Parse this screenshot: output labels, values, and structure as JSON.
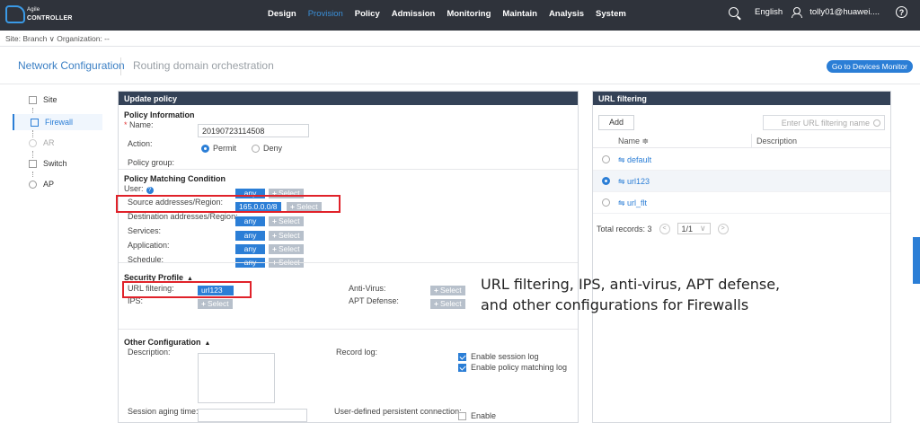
{
  "topbar": {
    "logo_line1": "Agile",
    "logo_line2": "CONTROLLER",
    "nav": [
      "Design",
      "Provision",
      "Policy",
      "Admission",
      "Monitoring",
      "Maintain",
      "Analysis",
      "System"
    ],
    "active_nav": "Provision",
    "language": "English",
    "user": "tolly01@huawei....",
    "help_icon": "?"
  },
  "breadcrumb": "Site: Branch ∨  Organization: --",
  "tabs": {
    "active": "Network Configuration",
    "other": "Routing domain orchestration",
    "go_button": "Go to Devices Monitor"
  },
  "sidebar": {
    "items": [
      {
        "label": "Site",
        "icon": "site-icon"
      },
      {
        "label": "Firewall",
        "icon": "firewall-icon"
      },
      {
        "label": "AR",
        "icon": "ar-icon"
      },
      {
        "label": "Switch",
        "icon": "switch-icon"
      },
      {
        "label": "AP",
        "icon": "ap-icon"
      }
    ],
    "active": "Firewall"
  },
  "policy": {
    "title": "Update policy",
    "info": {
      "title": "Policy Information",
      "name_label": "Name:",
      "name_value": "20190723114508",
      "action_label": "Action:",
      "permit": "Permit",
      "deny": "Deny",
      "group_label": "Policy group:"
    },
    "matching": {
      "title": "Policy Matching Condition",
      "user_label": "User:",
      "source_label": "Source addresses/Region:",
      "source_value": "165.0.0.0/8",
      "dest_label": "Destination addresses/Region:",
      "services_label": "Services:",
      "application_label": "Application:",
      "schedule_label": "Schedule:",
      "any": "any",
      "select": "Select"
    },
    "security": {
      "title": "Security Profile",
      "url_label": "URL filtering:",
      "url_value": "url123",
      "ips_label": "IPS:",
      "antivirus_label": "Anti-Virus:",
      "apt_label": "APT Defense:",
      "select": "Select"
    },
    "other": {
      "title": "Other Configuration",
      "description_label": "Description:",
      "record_log_label": "Record log:",
      "session_log": "Enable session log",
      "matching_log": "Enable policy matching log",
      "aging_label": "Session aging time:",
      "persistent_label": "User-defined persistent connection:",
      "enable": "Enable"
    }
  },
  "annotation": "URL filtering, IPS, anti-virus, APT defense, and other configurations for Firewalls",
  "url_filtering": {
    "title": "URL filtering",
    "add_button": "Add",
    "search_placeholder": "Enter URL filtering name",
    "col_name": "Name ≑",
    "col_description": "Description",
    "rows": [
      {
        "name": "default",
        "selected": false
      },
      {
        "name": "url123",
        "selected": true
      },
      {
        "name": "url_flt",
        "selected": false
      }
    ],
    "total": "Total records: 3",
    "page": "1/1"
  },
  "colors": {
    "accent": "#2b7ed6",
    "header": "#2f333b",
    "panel_head": "#344257",
    "highlight": "#e0222a"
  }
}
